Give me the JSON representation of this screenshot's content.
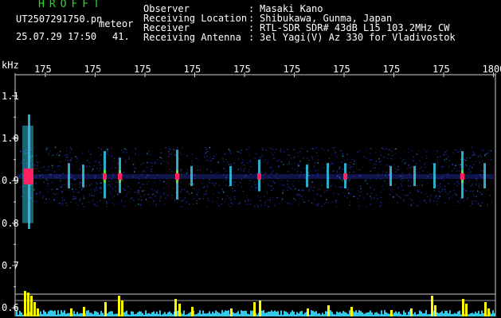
{
  "header": {
    "app_title": "HROFFT",
    "filename": "UT2507291750.pn",
    "meteor_label": "meteor",
    "datetime": "25.07.29 17:50",
    "count": "41."
  },
  "info": [
    {
      "label": "Observer",
      "value": "Masaki Kano"
    },
    {
      "label": "Receiving Location",
      "value": "Shibukawa, Gunma, Japan"
    },
    {
      "label": "Receiver",
      "value": "RTL-SDR SDR# 43dB L15 103.2MHz CW"
    },
    {
      "label": "Receiving Antenna",
      "value": "3el Yagi(V) Az 330 for Vladivostok"
    }
  ],
  "chart_data": {
    "type": "heatmap",
    "ylabel": "kHz",
    "y_ticks": [
      "1.1",
      "1.0",
      "0.9",
      "0.8",
      "0.7",
      "0.6"
    ],
    "x_ticks": [
      "175",
      "175",
      "175",
      "175",
      "175",
      "175",
      "175",
      "175",
      "175",
      "1800"
    ],
    "ylim": [
      0.58,
      1.15
    ],
    "carrier_khz": 0.91,
    "grid": false,
    "colors": {
      "axis": "#d0d0d0",
      "signal_low": "#2a3cd0",
      "signal_mid": "#36c8e8",
      "signal_hot": "#ff2060",
      "signal_green": "#60e040",
      "level_bars": "#ffff00",
      "level_base": "#36c8e8"
    }
  }
}
